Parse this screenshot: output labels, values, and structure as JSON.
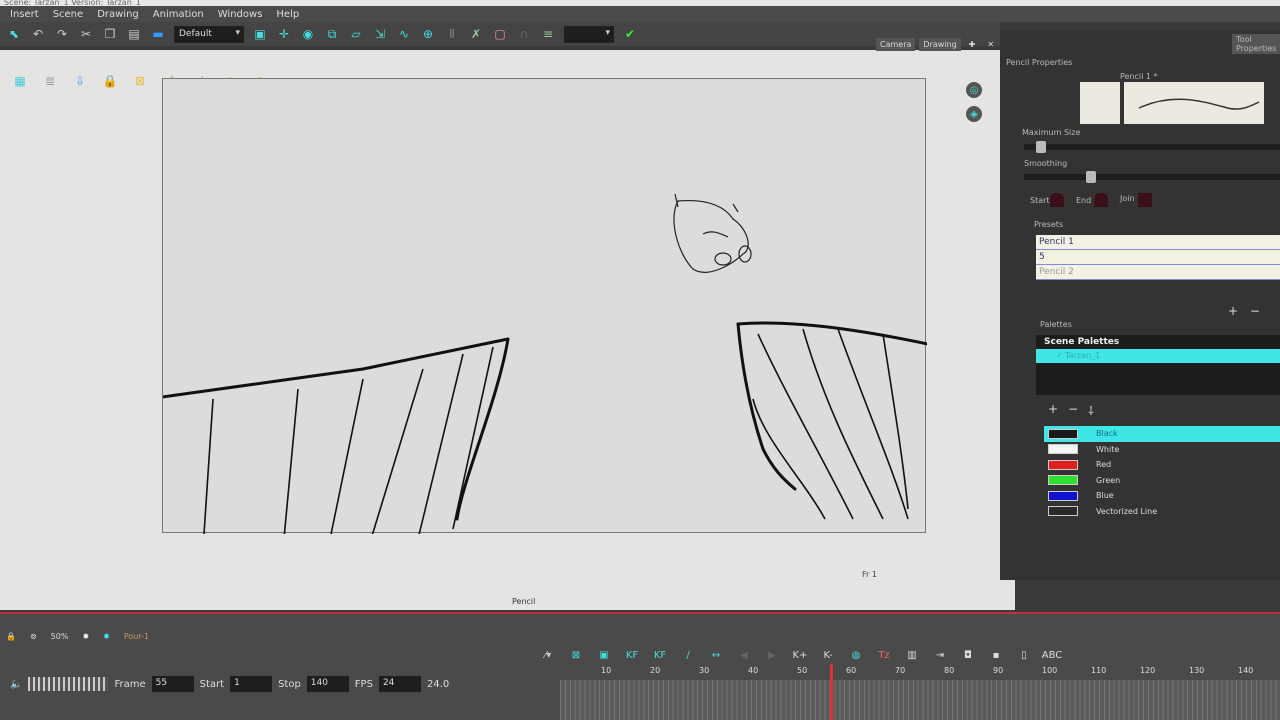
{
  "window": {
    "title": "Scene: Tarzan_1 Version: Tarzan_1"
  },
  "menu": [
    "Insert",
    "Scene",
    "Drawing",
    "Animation",
    "Windows",
    "Help"
  ],
  "toolbar": {
    "workspace_select": "Default"
  },
  "view_tabs": {
    "camera": "Camera",
    "drawing": "Drawing"
  },
  "viewport": {
    "frame_label": "Fr 1",
    "tool_label": "Pencil"
  },
  "tool_properties": {
    "tab": "Tool Properties",
    "title": "Pencil Properties",
    "brush_name": "Pencil 1 *",
    "max_size_label": "Maximum Size",
    "max_size_value": 0.05,
    "smoothing_label": "Smoothing",
    "smoothing_value": 0.25,
    "start_label": "Start",
    "end_label": "End",
    "join_label": "Join",
    "presets_label": "Presets",
    "presets": [
      "Pencil 1",
      "5",
      "Pencil 2"
    ]
  },
  "palettes": {
    "label": "Palettes",
    "scene_palettes": "Scene Palettes",
    "selected_palette": "✓ Tarzan_1",
    "colors": [
      {
        "name": "Black",
        "hex": "#1a1a1a"
      },
      {
        "name": "White",
        "hex": "#f5f5f5"
      },
      {
        "name": "Red",
        "hex": "#e02020"
      },
      {
        "name": "Green",
        "hex": "#30e030"
      },
      {
        "name": "Blue",
        "hex": "#1010d0"
      },
      {
        "name": "Vectorized Line",
        "hex": "#2a2a2a"
      }
    ]
  },
  "status": {
    "zoom": "50%",
    "layer": "Pour-1"
  },
  "playback": {
    "frame_label": "Frame",
    "frame": "55",
    "start_label": "Start",
    "start": "1",
    "stop_label": "Stop",
    "stop": "140",
    "fps_label": "FPS",
    "fps": "24",
    "fps_actual": "24.0"
  },
  "timeline": {
    "ticks": [
      "10",
      "20",
      "30",
      "40",
      "50",
      "60",
      "70",
      "80",
      "90",
      "100",
      "110",
      "120",
      "130",
      "140"
    ],
    "current_frame": 55
  },
  "colors": {
    "accent": "#3ee6e6",
    "playhead": "#e03040"
  }
}
